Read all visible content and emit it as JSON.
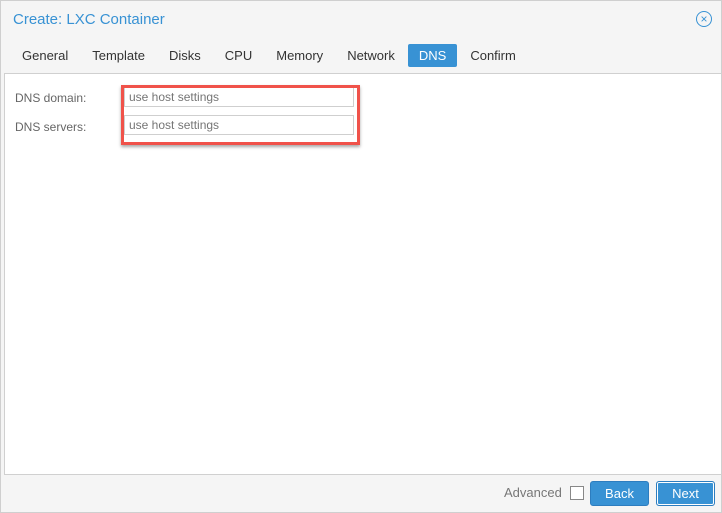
{
  "title": "Create: LXC Container",
  "tabs": [
    "General",
    "Template",
    "Disks",
    "CPU",
    "Memory",
    "Network",
    "DNS",
    "Confirm"
  ],
  "active_tab": "DNS",
  "fields": [
    {
      "label": "DNS domain:",
      "placeholder": "use host settings"
    },
    {
      "label": "DNS servers:",
      "placeholder": "use host settings"
    }
  ],
  "footer": {
    "advanced": "Advanced",
    "back": "Back",
    "next": "Next"
  },
  "accent": "#3892d4"
}
